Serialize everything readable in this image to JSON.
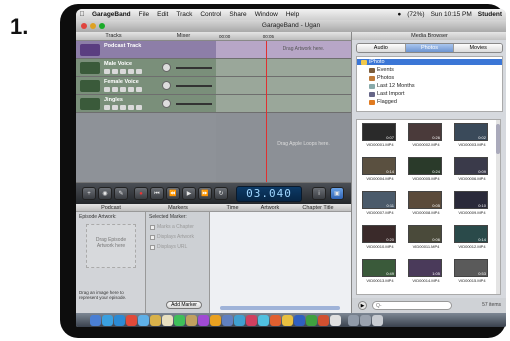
{
  "step_number": "1.",
  "menubar": {
    "app_name": "GarageBand",
    "items": [
      "File",
      "Edit",
      "Track",
      "Control",
      "Share",
      "Window",
      "Help"
    ],
    "battery": "(72%)",
    "clock": "Sun 10:15 PM",
    "user": "Student"
  },
  "window_title": "GarageBand - Ugan",
  "headers": {
    "tracks": "Tracks",
    "mixer": "Mixer"
  },
  "tracks": [
    {
      "name": "Podcast Track",
      "color": "#9b7fb8"
    },
    {
      "name": "Male Voice",
      "color": "#7a9a6a"
    },
    {
      "name": "Female Voice",
      "color": "#7a9a6a"
    },
    {
      "name": "Jingles",
      "color": "#7a9a6a"
    }
  ],
  "hints": {
    "artwork": "Drag Artwork here.",
    "loops": "Drag Apple Loops here."
  },
  "transport": {
    "lcd": "03.040"
  },
  "podcast_panel": {
    "header": "Podcast",
    "episode_artwork": "Episode Artwork:",
    "drop_text": "Drag Episode Artwork here",
    "drop_hint": "Drag an image here to represent your episode."
  },
  "markers_panel": {
    "header": "Markers",
    "selected_marker": "Selected Marker:",
    "options": [
      "Marks a Chapter",
      "Displays Artwork",
      "Displays URL"
    ],
    "add_button": "Add Marker"
  },
  "marker_table": {
    "columns": [
      "Time",
      "Artwork",
      "Chapter Title"
    ]
  },
  "media_browser": {
    "title": "Media Browser",
    "tabs": [
      "Audio",
      "Photos",
      "Movies"
    ],
    "active_tab": "Photos",
    "sources": [
      "iPhoto",
      "Events",
      "Photos",
      "Last 12 Months",
      "Last Import",
      "Flagged"
    ],
    "videos": [
      {
        "label": "VID00001.MP4",
        "duration": "0:07"
      },
      {
        "label": "VID00002.MP4",
        "duration": "0:26"
      },
      {
        "label": "VID00003.MP4",
        "duration": "0:02"
      },
      {
        "label": "VID00004.MP4",
        "duration": "0:14"
      },
      {
        "label": "VID00005.MP4",
        "duration": "0:24"
      },
      {
        "label": "VID00006.MP4",
        "duration": "0:09"
      },
      {
        "label": "VID00007.MP4",
        "duration": "0:11"
      },
      {
        "label": "VID00008.MP4",
        "duration": "0:05"
      },
      {
        "label": "VID00009.MP4",
        "duration": "0:10"
      },
      {
        "label": "VID00010.MP4",
        "duration": "0:20"
      },
      {
        "label": "VID00011.MP4",
        "duration": "0:06"
      },
      {
        "label": "VID00012.MP4",
        "duration": "0:14"
      },
      {
        "label": "VID00013.MP4",
        "duration": "0:49"
      },
      {
        "label": "VID00014.MP4",
        "duration": "1:05"
      },
      {
        "label": "VID00015.MP4",
        "duration": "0:53"
      }
    ],
    "search_placeholder": "Q-",
    "count": "57 items"
  }
}
